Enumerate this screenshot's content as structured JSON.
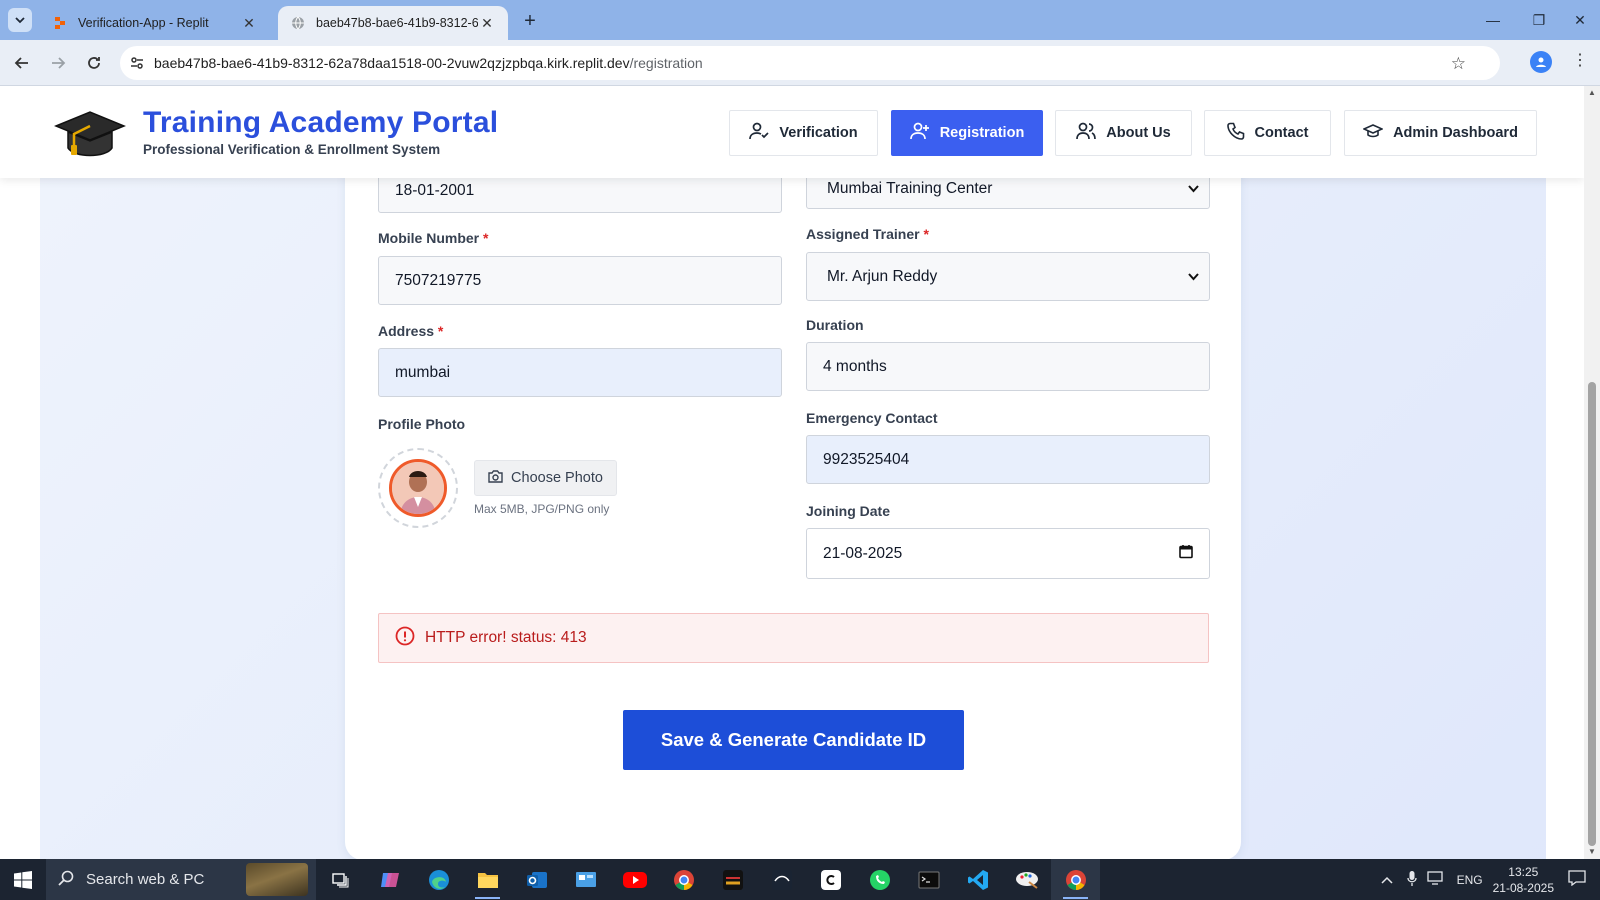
{
  "browser": {
    "tabs": [
      {
        "title": "Verification-App - Replit",
        "active": false
      },
      {
        "title": "baeb47b8-bae6-41b9-8312-62a78daa1518",
        "active": true
      }
    ],
    "url_host": "baeb47b8-bae6-41b9-8312-62a78daa1518-00-2vuw2qzjzpbqa.kirk.replit.dev",
    "url_path": "/registration"
  },
  "header": {
    "title": "Training Academy Portal",
    "subtitle": "Professional Verification & Enrollment System",
    "nav": [
      {
        "label": "Verification",
        "icon": "user-check-icon",
        "active": false
      },
      {
        "label": "Registration",
        "icon": "user-plus-icon",
        "active": true
      },
      {
        "label": "About Us",
        "icon": "users-icon",
        "active": false
      },
      {
        "label": "Contact",
        "icon": "phone-icon",
        "active": false
      },
      {
        "label": "Admin Dashboard",
        "icon": "graduation-cap-icon",
        "active": false
      }
    ]
  },
  "form": {
    "dob_value": "18-01-2001",
    "center_value": "Mumbai Training Center",
    "mobile_label": "Mobile Number",
    "mobile_value": "7507219775",
    "trainer_label": "Assigned Trainer",
    "trainer_value": "Mr. Arjun Reddy",
    "address_label": "Address",
    "address_value": "mumbai",
    "duration_label": "Duration",
    "duration_value": "4 months",
    "photo_label": "Profile Photo",
    "choose_photo": "Choose Photo",
    "photo_hint": "Max 5MB, JPG/PNG only",
    "emergency_label": "Emergency Contact",
    "emergency_value": "9923525404",
    "joining_label": "Joining Date",
    "joining_value": "21-08-2025",
    "required_mark": "*",
    "error_message": "HTTP error! status: 413",
    "submit_label": "Save & Generate Candidate ID"
  },
  "taskbar": {
    "search_placeholder": "Search web & PC",
    "language": "ENG",
    "time": "13:25",
    "date": "21-08-2025"
  },
  "colors": {
    "brand": "#2b4fdc",
    "active_nav": "#3b5ff0",
    "submit": "#1d4ed8",
    "error_text": "#b91c1c",
    "error_bg": "#fdf1f1"
  }
}
